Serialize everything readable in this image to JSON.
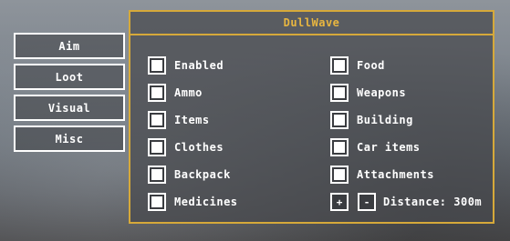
{
  "window": {
    "title": "DullWave"
  },
  "sidebar": {
    "tabs": [
      {
        "label": "Aim"
      },
      {
        "label": "Loot"
      },
      {
        "label": "Visual"
      },
      {
        "label": "Misc"
      }
    ]
  },
  "options": {
    "left": [
      {
        "label": "Enabled",
        "checked": false
      },
      {
        "label": "Ammo",
        "checked": false
      },
      {
        "label": "Items",
        "checked": false
      },
      {
        "label": "Clothes",
        "checked": false
      },
      {
        "label": "Backpack",
        "checked": false
      },
      {
        "label": "Medicines",
        "checked": false
      }
    ],
    "right": [
      {
        "label": "Food",
        "checked": false
      },
      {
        "label": "Weapons",
        "checked": false
      },
      {
        "label": "Building",
        "checked": false
      },
      {
        "label": "Car items",
        "checked": false
      },
      {
        "label": "Attachments",
        "checked": false
      }
    ]
  },
  "distance": {
    "increase_label": "+",
    "decrease_label": "-",
    "text": "Distance: 300m"
  },
  "colors": {
    "accent": "#d6a93a",
    "title_text": "#e8b640",
    "text": "#ffffff",
    "panel_bg": "#46484c"
  }
}
